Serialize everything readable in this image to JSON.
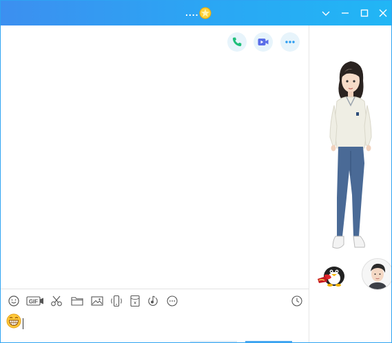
{
  "window": {
    "title": "....",
    "badge_icon": "vip-star-badge-icon",
    "controls": [
      "chevron-down-icon",
      "minimize-icon",
      "maximize-icon",
      "close-icon"
    ]
  },
  "chat_header": {
    "actions": [
      {
        "name": "voice-call",
        "icon": "phone-icon",
        "color": "#1fbf7a"
      },
      {
        "name": "video-call",
        "icon": "video-camera-icon",
        "color": "#5a6ee8"
      },
      {
        "name": "more",
        "icon": "more-dots-icon",
        "color": "#2b9cf0"
      }
    ]
  },
  "toolbar": {
    "items": [
      "smiley-icon",
      "gif-icon",
      "scissors-icon",
      "folder-icon",
      "image-icon",
      "shake-icon",
      "red-packet-icon",
      "music-icon",
      "more-circle-icon"
    ],
    "gif_label": "GIF",
    "history_icon": "clock-icon"
  },
  "input": {
    "current_value": "",
    "emoji_icon": "grinning-emoji-icon"
  },
  "side_panel": {
    "character": "dressed-avatar-show",
    "pet_icon": "penguin-pet-icon",
    "profile_icon": "profile-avatar"
  },
  "colors": {
    "title_gradient_start": "#3c8ff0",
    "title_gradient_end": "#21b6f5",
    "accent": "#2b9cf0",
    "call_green": "#1fbf7a",
    "video_purple": "#5a6ee8"
  }
}
